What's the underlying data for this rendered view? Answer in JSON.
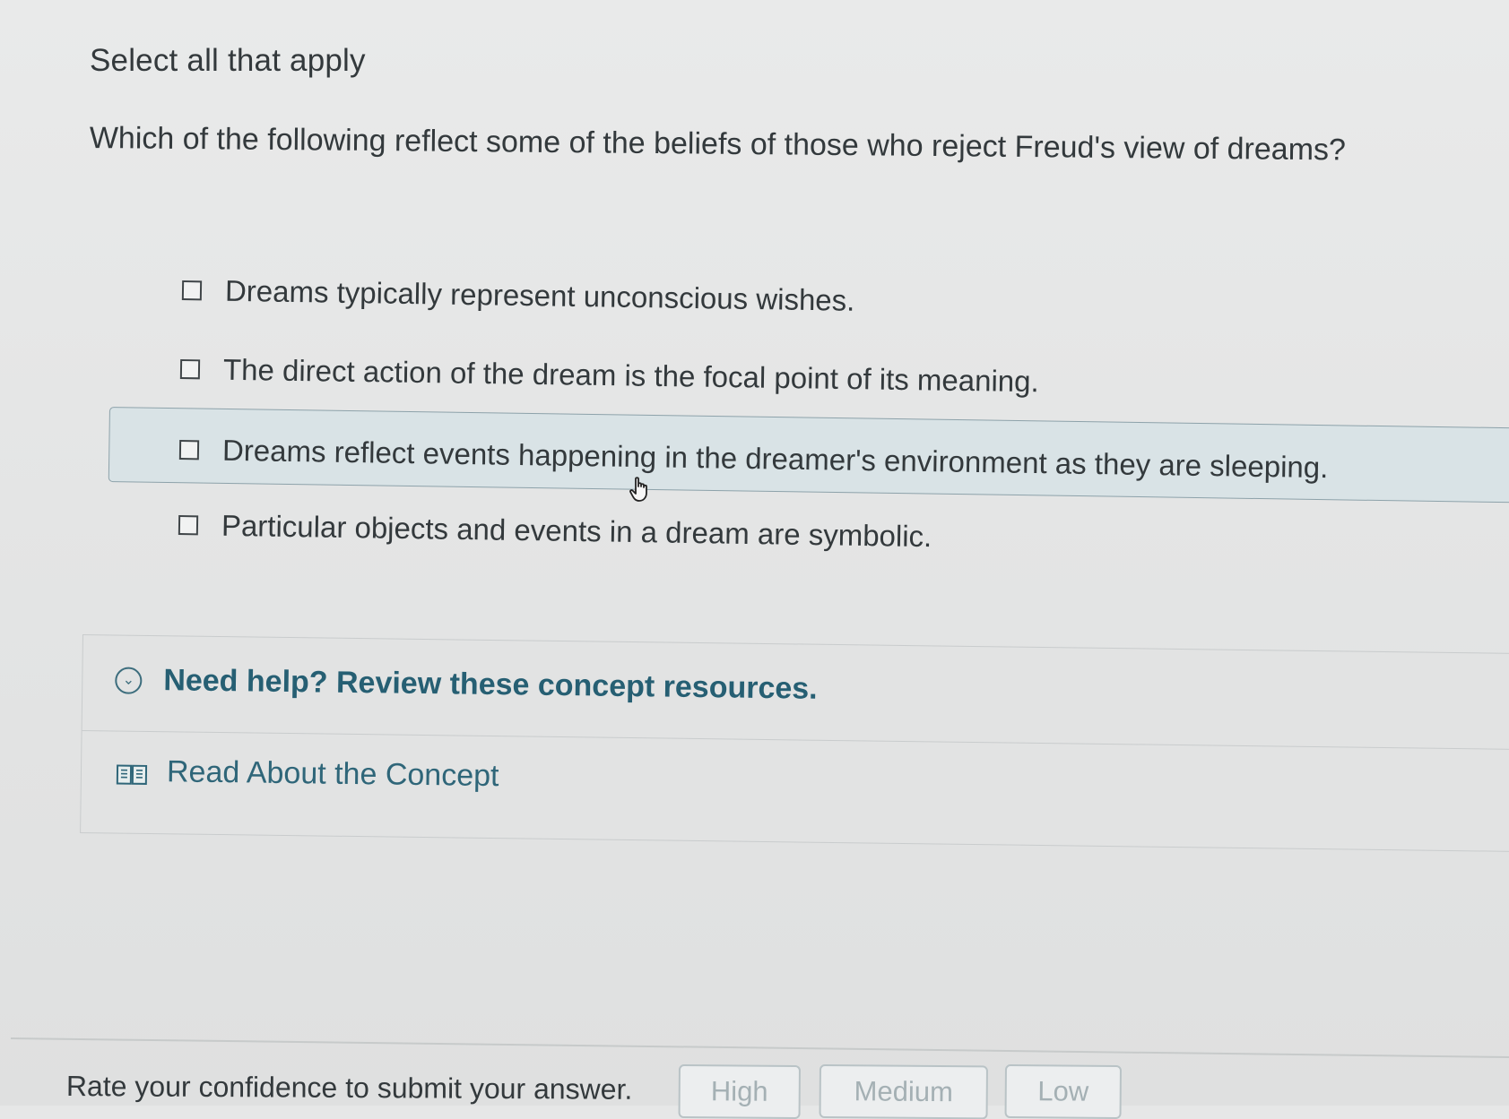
{
  "instruction": "Select all that apply",
  "question": "Which of the following reflect some of the beliefs of those who reject Freud's view of dreams?",
  "options": [
    {
      "label": "Dreams typically represent unconscious wishes.",
      "checked": false
    },
    {
      "label": "The direct action of the dream is the focal point of its meaning.",
      "checked": false
    },
    {
      "label": "Dreams reflect events happening in the dreamer's environment as they are sleeping.",
      "checked": false,
      "hovered": true
    },
    {
      "label": "Particular objects and events in a dream are symbolic.",
      "checked": false
    }
  ],
  "help": {
    "title": "Need help? Review these concept resources.",
    "toggle_icon": "chevron-down-circle-icon",
    "resources": [
      {
        "label": "Read About the Concept",
        "icon": "book-icon"
      }
    ]
  },
  "confidence": {
    "label": "Rate your confidence to submit your answer.",
    "buttons": [
      "High",
      "Medium",
      "Low"
    ]
  },
  "colors": {
    "accent": "#265f73",
    "highlight": "#d9e3e6",
    "button_text": "#a4b0b4"
  }
}
